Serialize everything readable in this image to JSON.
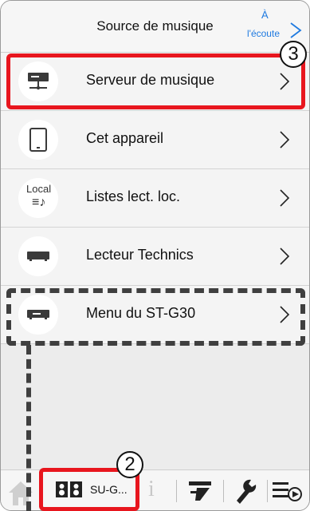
{
  "header": {
    "title": "Source de musique",
    "now_playing_top": "À",
    "now_playing_label": "l'écoute"
  },
  "rows": [
    {
      "label": "Serveur de musique",
      "icon": "server-icon"
    },
    {
      "label": "Cet appareil",
      "icon": "tablet-icon"
    },
    {
      "label": "Listes lect. loc.",
      "icon": "local-playlist-icon",
      "icon_text": "Local",
      "icon_glyph": "≡♪"
    },
    {
      "label": "Lecteur Technics",
      "icon": "player-icon"
    },
    {
      "label": "Menu du ST-G30",
      "icon": "device-icon"
    }
  ],
  "tabbar": {
    "speaker_label": "SU-G...",
    "info_glyph": "i"
  },
  "annotations": {
    "badge_server": "3",
    "badge_speaker": "2"
  },
  "colors": {
    "accent": "#1f7ae0",
    "highlight_red": "#e8161e",
    "highlight_dashed": "#3f3f3f",
    "row_bg": "#f4f4f4"
  }
}
